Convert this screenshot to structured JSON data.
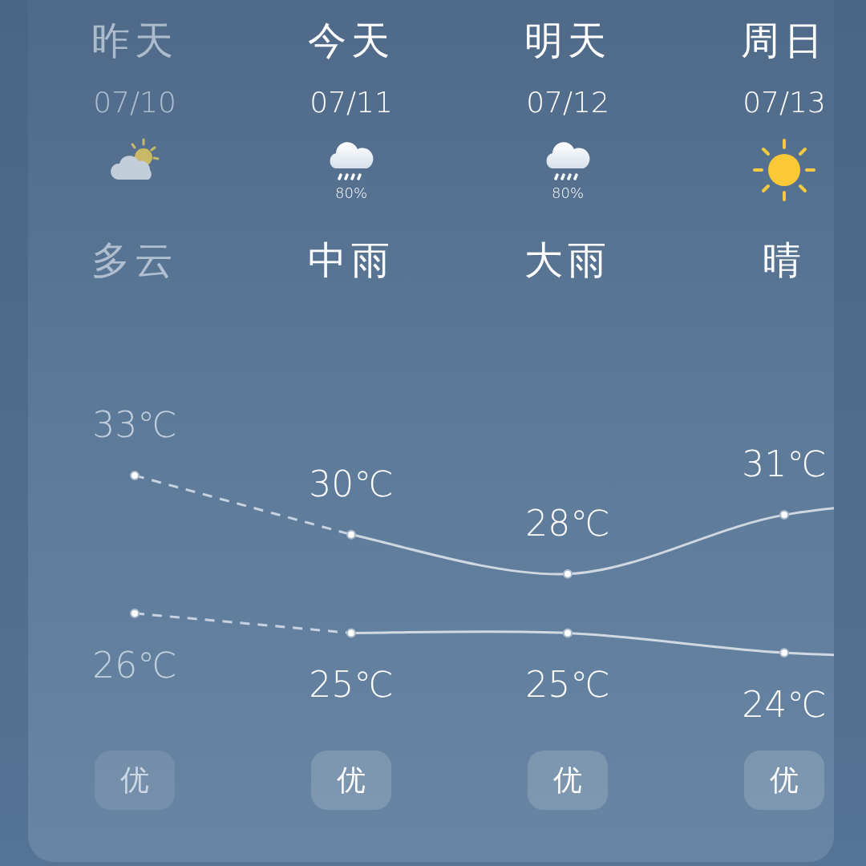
{
  "days": [
    {
      "name": "昨天",
      "date": "07/10",
      "kind": "partly_cloudy",
      "condition": "多云",
      "past": true,
      "high": "33℃",
      "low": "26℃",
      "aqi": "优"
    },
    {
      "name": "今天",
      "date": "07/11",
      "kind": "rain",
      "precip": "80%",
      "condition": "中雨",
      "past": false,
      "high": "30℃",
      "low": "25℃",
      "aqi": "优"
    },
    {
      "name": "明天",
      "date": "07/12",
      "kind": "rain",
      "precip": "80%",
      "condition": "大雨",
      "past": false,
      "high": "28℃",
      "low": "25℃",
      "aqi": "优"
    },
    {
      "name": "周日",
      "date": "07/13",
      "kind": "sun",
      "condition": "晴",
      "past": false,
      "high": "31℃",
      "low": "24℃",
      "aqi": "优"
    }
  ]
}
